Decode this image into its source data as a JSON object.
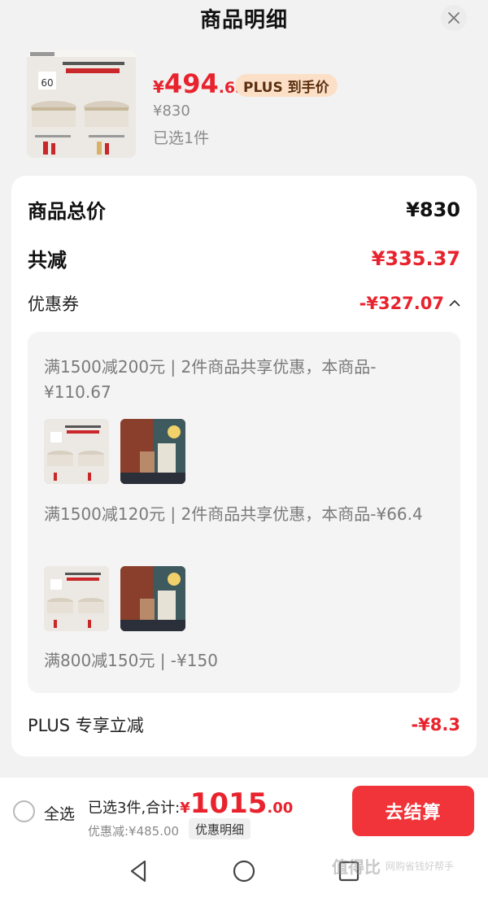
{
  "header": {
    "title": "商品明细"
  },
  "product": {
    "price_symbol": "¥",
    "price_int": "494",
    "price_dec": ".63",
    "plus_badge": "PLUS 到手价",
    "orig_price": "¥830",
    "selected": "已选1件"
  },
  "summary": {
    "total_label": "商品总价",
    "total_value": "¥830",
    "reduce_label": "共减",
    "reduce_value": "¥335.37",
    "coupon_label": "优惠券",
    "coupon_value": "-¥327.07",
    "plus_label": "PLUS 专享立减",
    "plus_value": "-¥8.3"
  },
  "coupons": [
    {
      "text": "满1500减200元 | 2件商品共享优惠，本商品-¥110.67"
    },
    {
      "text": "满1500减120元 | 2件商品共享优惠，本商品-¥66.4"
    },
    {
      "text": "满800减150元 | -¥150"
    }
  ],
  "bottom": {
    "select_all": "全选",
    "summary_prefix": "已选3件,合计:",
    "total_symbol": "¥",
    "total_int": "1015",
    "total_dec": ".00",
    "discount": "优惠减:¥485.00",
    "detail_chip": "优惠明细",
    "checkout": "去结算"
  },
  "watermark": {
    "logo": "值得比",
    "tag": "网购省钱好帮手"
  },
  "colors": {
    "accent": "#e8232e",
    "checkout": "#f0343a",
    "plus_badge_bg": "#fbe0c7"
  }
}
